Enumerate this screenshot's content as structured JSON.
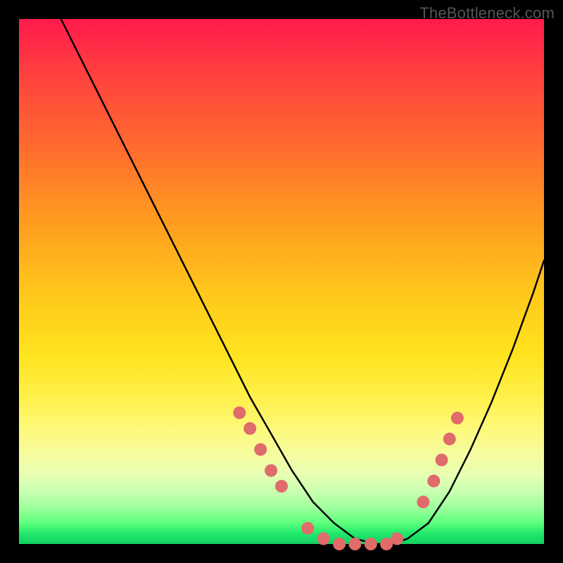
{
  "watermark": "TheBottleneck.com",
  "chart_data": {
    "type": "line",
    "title": "",
    "xlabel": "",
    "ylabel": "",
    "xlim": [
      0,
      100
    ],
    "ylim": [
      0,
      100
    ],
    "series": [
      {
        "name": "curve",
        "color": "#000000",
        "x": [
          8,
          12,
          16,
          20,
          24,
          28,
          32,
          36,
          40,
          44,
          48,
          52,
          56,
          60,
          64,
          68,
          71,
          74,
          78,
          82,
          86,
          90,
          94,
          98,
          100
        ],
        "y": [
          100,
          92,
          84,
          76,
          68,
          60,
          52,
          44,
          36,
          28,
          21,
          14,
          8,
          4,
          1,
          0,
          0,
          1,
          4,
          10,
          18,
          27,
          37,
          48,
          54
        ]
      }
    ],
    "markers": {
      "name": "dots",
      "color": "#e06b6b",
      "radius_px": 9,
      "points": [
        {
          "x": 42,
          "y": 25
        },
        {
          "x": 44,
          "y": 22
        },
        {
          "x": 46,
          "y": 18
        },
        {
          "x": 48,
          "y": 14
        },
        {
          "x": 50,
          "y": 11
        },
        {
          "x": 55,
          "y": 3
        },
        {
          "x": 58,
          "y": 1
        },
        {
          "x": 61,
          "y": 0
        },
        {
          "x": 64,
          "y": 0
        },
        {
          "x": 67,
          "y": 0
        },
        {
          "x": 70,
          "y": 0
        },
        {
          "x": 72,
          "y": 1
        },
        {
          "x": 77,
          "y": 8
        },
        {
          "x": 79,
          "y": 12
        },
        {
          "x": 80.5,
          "y": 16
        },
        {
          "x": 82,
          "y": 20
        },
        {
          "x": 83.5,
          "y": 24
        }
      ]
    }
  }
}
